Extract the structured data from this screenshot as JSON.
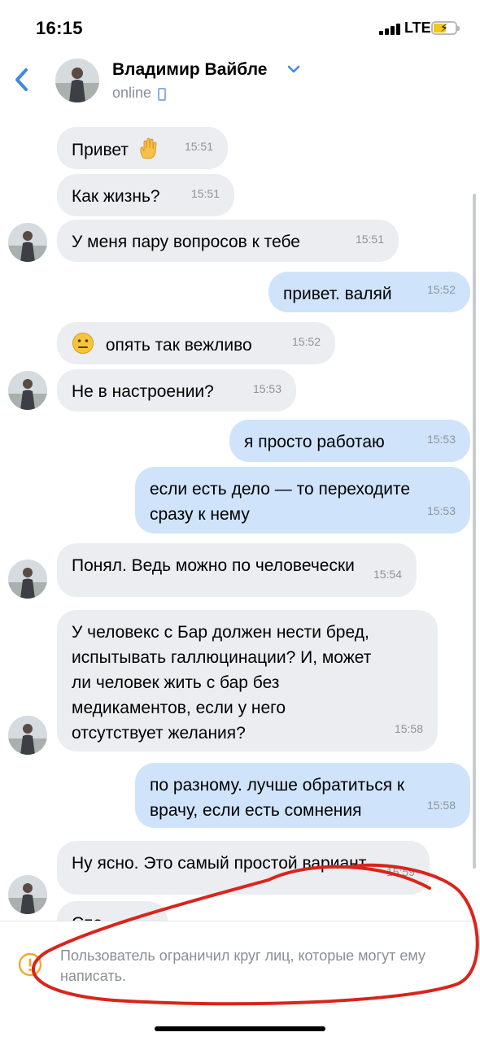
{
  "status_bar": {
    "time": "16:15",
    "network": "LTE"
  },
  "header": {
    "back_icon": "chevron-left-icon",
    "contact_name": "Владимир Вайбле",
    "status": "online"
  },
  "messages": [
    {
      "dir": "in",
      "text": "Привет",
      "emoji": "waving-hand-icon",
      "time": "15:51"
    },
    {
      "dir": "in",
      "text": "Как жизнь?",
      "time": "15:51"
    },
    {
      "dir": "in",
      "text": "У меня пару вопросов к тебе",
      "time": "15:51"
    },
    {
      "dir": "out",
      "text": "привет. валяй",
      "time": "15:52"
    },
    {
      "dir": "in",
      "text": "опять так вежливо",
      "emoji": "neutral-face-icon",
      "time": "15:52"
    },
    {
      "dir": "in",
      "text": "Не в настроении?",
      "time": "15:53"
    },
    {
      "dir": "out",
      "text": "я просто работаю",
      "time": "15:53"
    },
    {
      "dir": "out",
      "text": "если есть дело — то переходите\nсразу к нему",
      "time": "15:53"
    },
    {
      "dir": "in",
      "text": "Понял. Ведь можно по человечески",
      "time": "15:54"
    },
    {
      "dir": "in",
      "text": "У человекс с Бар должен нести бред,\nиспытывать галлюцинации? И, может\nли человек жить с бар без\nмедикаментов, если у него\nотсутствует желания?",
      "time": "15:58"
    },
    {
      "dir": "out",
      "text": "по разному. лучше обратиться к\nврачу, если есть сомнения",
      "time": "15:58"
    },
    {
      "dir": "in",
      "text": "Ну ясно. Это самый простой вариант",
      "time": "15:59"
    },
    {
      "dir": "in",
      "text": "Спа",
      "time": ""
    }
  ],
  "restriction": {
    "icon": "warning-circle-icon",
    "text": "Пользователь ограничил круг лиц, которые могут ему написать."
  },
  "colors": {
    "incoming_bubble": "#ebedf0",
    "outgoing_bubble": "#cfe4fb",
    "accent": "#3f8ae0",
    "annotation": "#d8251c"
  }
}
